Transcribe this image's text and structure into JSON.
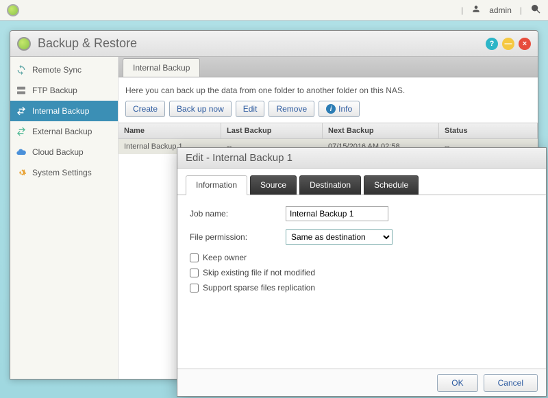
{
  "topbar": {
    "user": "admin"
  },
  "window": {
    "title": "Backup & Restore",
    "help": "?",
    "min": "—",
    "close": "×"
  },
  "sidebar": {
    "items": [
      {
        "label": "Remote Sync"
      },
      {
        "label": "FTP Backup"
      },
      {
        "label": "Internal Backup"
      },
      {
        "label": "External Backup"
      },
      {
        "label": "Cloud Backup"
      },
      {
        "label": "System Settings"
      }
    ]
  },
  "main": {
    "tab": "Internal Backup",
    "description": "Here you can back up the data from one folder to another folder on this NAS.",
    "toolbar": {
      "create": "Create",
      "backup_now": "Back up now",
      "edit": "Edit",
      "remove": "Remove",
      "info": "Info"
    },
    "columns": {
      "name": "Name",
      "last": "Last Backup",
      "next": "Next Backup",
      "status": "Status"
    },
    "rows": [
      {
        "name": "Internal Backup 1",
        "last": "--",
        "next": "07/15/2016 AM 02:58",
        "status": "--"
      }
    ]
  },
  "dialog": {
    "title": "Edit - Internal Backup 1",
    "tabs": {
      "info": "Information",
      "source": "Source",
      "dest": "Destination",
      "sched": "Schedule"
    },
    "form": {
      "job_name_label": "Job name:",
      "job_name_value": "Internal Backup 1",
      "file_perm_label": "File permission:",
      "file_perm_value": "Same as destination",
      "keep_owner": "Keep owner",
      "skip_existing": "Skip existing file if not modified",
      "sparse": "Support sparse files replication"
    },
    "ok": "OK",
    "cancel": "Cancel"
  }
}
